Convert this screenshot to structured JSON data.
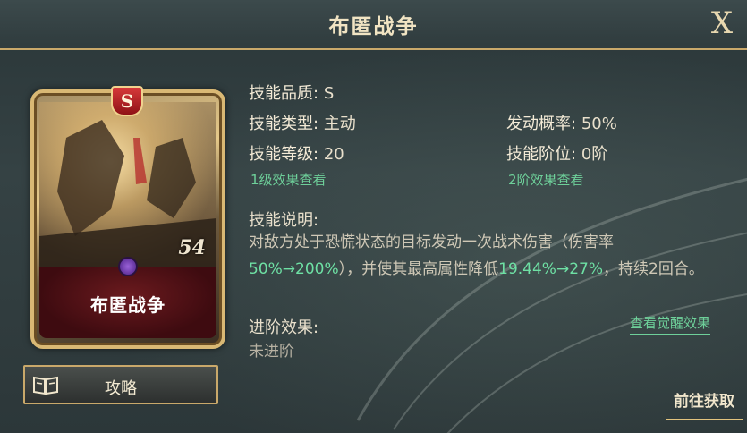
{
  "window": {
    "title": "布匿战争",
    "close_label": "X"
  },
  "card": {
    "grade_badge": "S",
    "name": "布匿战争",
    "art_number": "54"
  },
  "guide_button": {
    "label": "攻略",
    "icon": "book-icon"
  },
  "skill": {
    "quality_label": "技能品质:",
    "quality_value": "S",
    "type_label": "技能类型:",
    "type_value": "主动",
    "level_label": "技能等级:",
    "level_value": "20",
    "prob_label": "发动概率:",
    "prob_value": "50%",
    "tier_label": "技能阶位:",
    "tier_value": "0阶",
    "level_effect_link": "1级效果查看",
    "tier_effect_link": "2阶效果查看"
  },
  "description": {
    "label": "技能说明:",
    "part1": "对敌方处于恐慌状态的目标发动一次战术伤害（伤害率",
    "hl1": "50%→200%",
    "part2": "），并使其最高属性降低",
    "hl2": "19.44%→27%",
    "part3": "，持续2回合。"
  },
  "advance": {
    "label": "进阶效果:",
    "value": "未进阶",
    "awaken_link": "查看觉醒效果"
  },
  "get_button": {
    "label": "前往获取"
  },
  "colors": {
    "accent_gold": "#c9a86a",
    "highlight_green": "#6ee0a4"
  }
}
